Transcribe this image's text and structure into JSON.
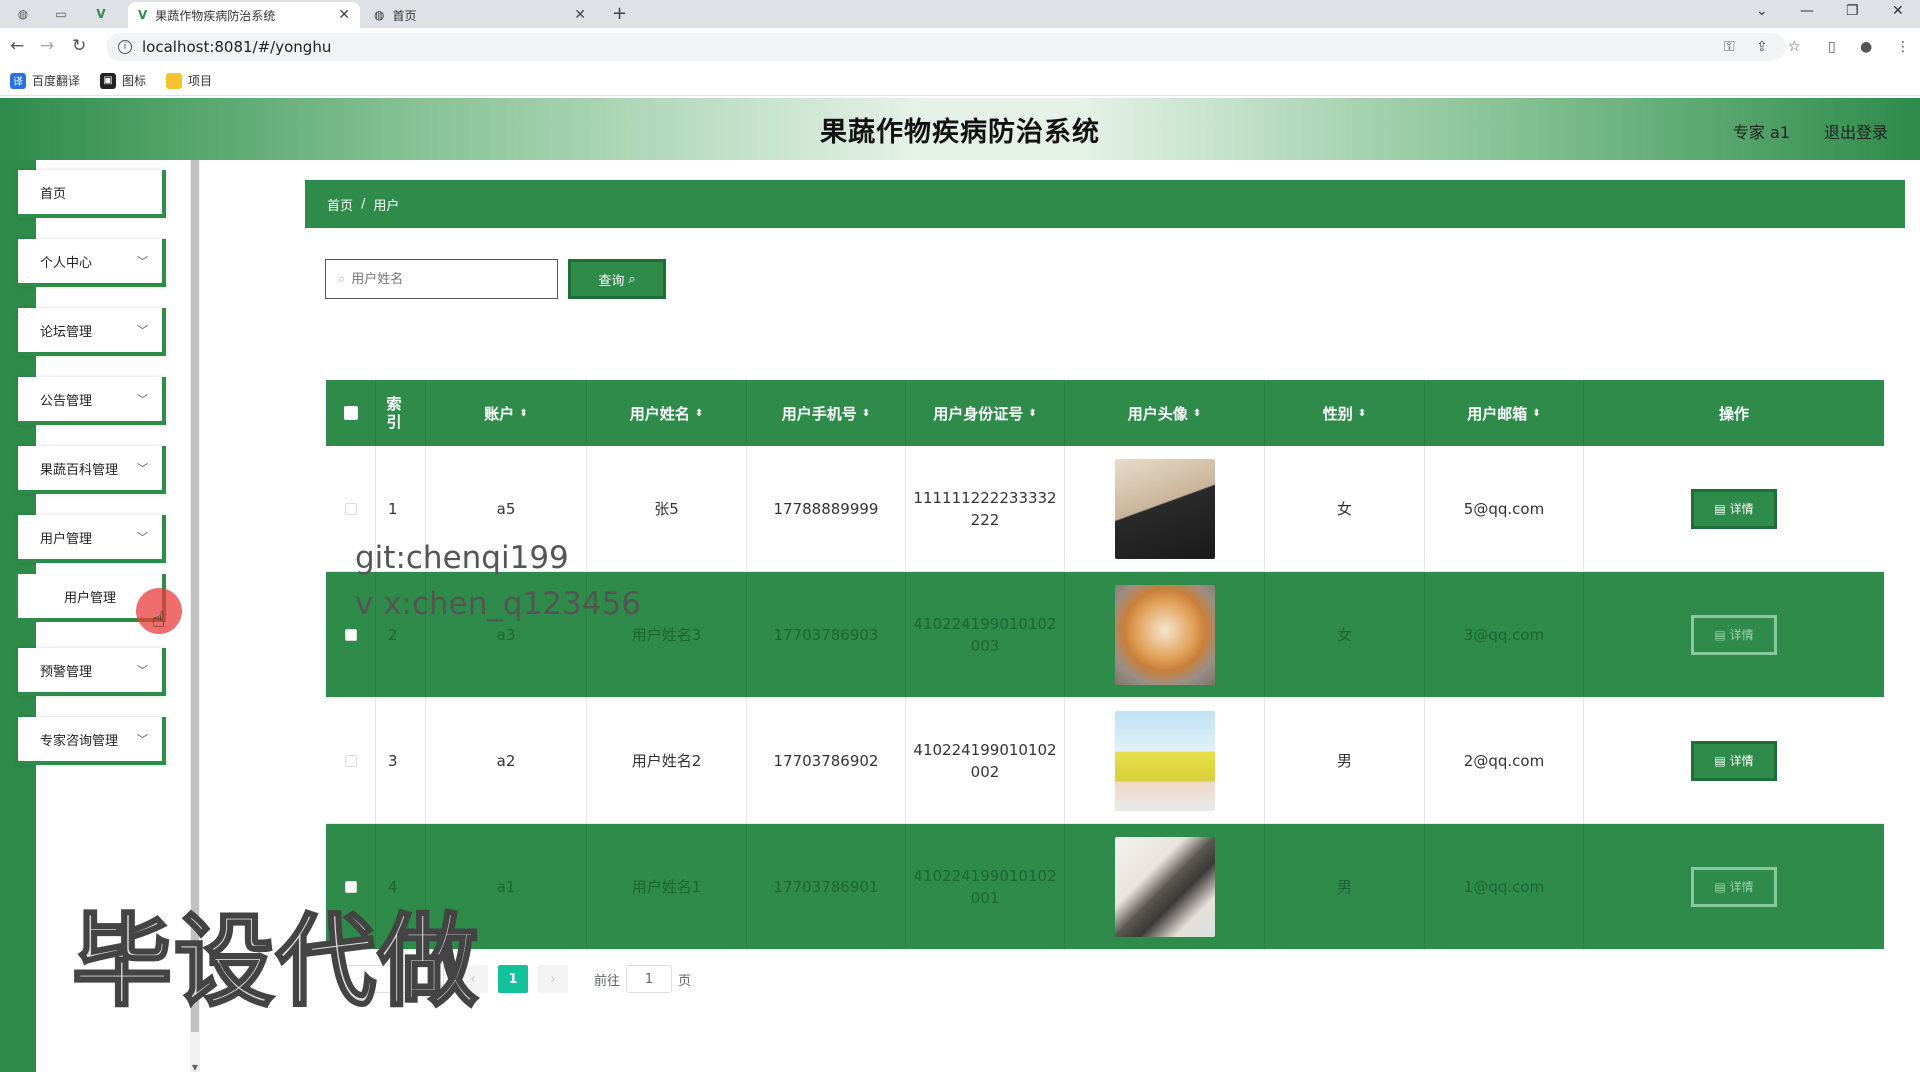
{
  "browser": {
    "tabs": [
      {
        "title": "果蔬作物疾病防治系统",
        "active": true
      },
      {
        "title": "首页",
        "active": false
      }
    ],
    "new_tab": "+",
    "url": "localhost:8081/#/yonghu",
    "bookmarks": [
      "百度翻译",
      "图标",
      "项目"
    ]
  },
  "header": {
    "title": "果蔬作物疾病防治系统",
    "user": "专家 a1",
    "logout": "退出登录"
  },
  "sidebar": {
    "items": [
      {
        "label": "首页",
        "has_arrow": false
      },
      {
        "label": "个人中心",
        "has_arrow": true
      },
      {
        "label": "论坛管理",
        "has_arrow": true
      },
      {
        "label": "公告管理",
        "has_arrow": true
      },
      {
        "label": "果蔬百科管理",
        "has_arrow": true
      },
      {
        "label": "用户管理",
        "has_arrow": true
      },
      {
        "label": "预警管理",
        "has_arrow": true
      },
      {
        "label": "专家咨询管理",
        "has_arrow": true
      }
    ],
    "submenu": {
      "label": "用户管理"
    }
  },
  "breadcrumb": {
    "home": "首页",
    "separator": "/",
    "current": "用户"
  },
  "search": {
    "placeholder": "用户姓名",
    "button": "查询"
  },
  "table": {
    "columns": [
      "索引",
      "账户",
      "用户姓名",
      "用户手机号",
      "用户身份证号",
      "用户头像",
      "性别",
      "用户邮箱",
      "操作"
    ],
    "rows": [
      {
        "index": "1",
        "account": "a5",
        "name": "张5",
        "phone": "17788889999",
        "id_card": "111111222233332222",
        "avatar": "photo-man",
        "gender": "女",
        "email": "5@qq.com",
        "action": "详情"
      },
      {
        "index": "2",
        "account": "a3",
        "name": "用户姓名3",
        "phone": "17703786903",
        "id_card": "410224199010102003",
        "avatar": "photo-dog",
        "gender": "女",
        "email": "3@qq.com",
        "action": "详情"
      },
      {
        "index": "3",
        "account": "a2",
        "name": "用户姓名2",
        "phone": "17703786902",
        "id_card": "410224199010102002",
        "avatar": "photo-girl-yellow",
        "gender": "男",
        "email": "2@qq.com",
        "action": "详情"
      },
      {
        "index": "4",
        "account": "a1",
        "name": "用户姓名1",
        "phone": "17703786901",
        "id_card": "410224199010102001",
        "avatar": "photo-anime-girl",
        "gender": "男",
        "email": "1@qq.com",
        "action": "详情"
      }
    ]
  },
  "pagination": {
    "current_page": "1",
    "goto_label": "前往",
    "goto_value": "1",
    "page_suffix": "页"
  },
  "overlays": {
    "watermark_line1": "git:chenqi199",
    "watermark_line2": "v x:chen_q123456",
    "watermark_big": "毕设代做"
  },
  "colors": {
    "primary": "#2e8b4a",
    "accent_page": "#13c29a"
  }
}
